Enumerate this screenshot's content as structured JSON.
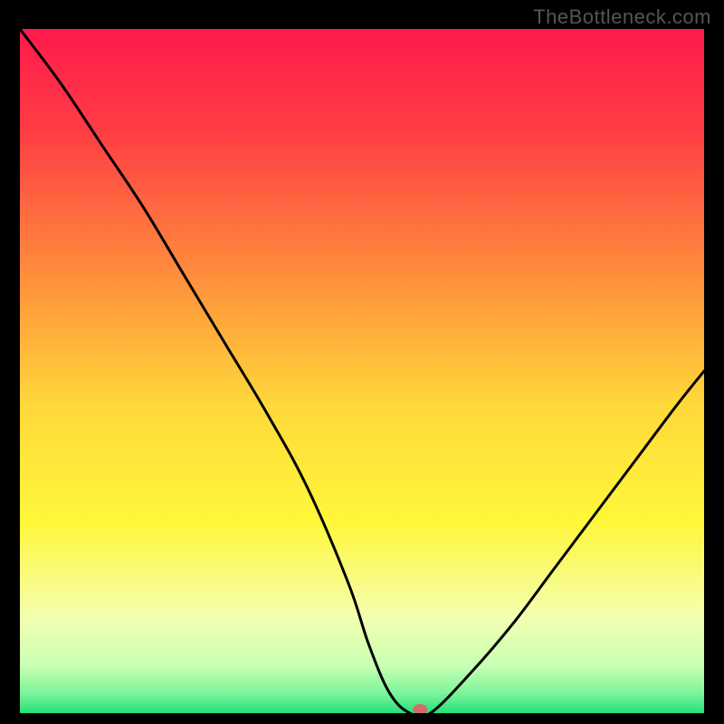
{
  "watermark": "TheBottleneck.com",
  "chart_data": {
    "type": "line",
    "title": "",
    "xlabel": "",
    "ylabel": "",
    "xlim": [
      0,
      100
    ],
    "ylim": [
      0,
      100
    ],
    "grid": false,
    "series": [
      {
        "name": "curve",
        "x": [
          0,
          6,
          12,
          18,
          24,
          30,
          36,
          42,
          48,
          51,
          54,
          57,
          60,
          66,
          72,
          78,
          84,
          90,
          96,
          100
        ],
        "values": [
          100,
          92,
          83,
          74,
          64,
          54,
          44,
          33,
          19,
          10,
          3,
          0,
          0,
          6,
          13,
          21,
          29,
          37,
          45,
          50
        ]
      }
    ],
    "marker": {
      "x": 58.5,
      "y": 0
    },
    "gradient_stops": [
      {
        "offset": 0.0,
        "color": "#ff1a4b"
      },
      {
        "offset": 0.15,
        "color": "#ff3d45"
      },
      {
        "offset": 0.35,
        "color": "#ff8a3c"
      },
      {
        "offset": 0.55,
        "color": "#ffd83a"
      },
      {
        "offset": 0.72,
        "color": "#fff73a"
      },
      {
        "offset": 0.86,
        "color": "#f4ffb0"
      },
      {
        "offset": 0.93,
        "color": "#c9ffb3"
      },
      {
        "offset": 0.97,
        "color": "#7ef59b"
      },
      {
        "offset": 1.0,
        "color": "#25e07a"
      }
    ],
    "marker_color": "#d46a6a",
    "curve_color": "#000000"
  }
}
